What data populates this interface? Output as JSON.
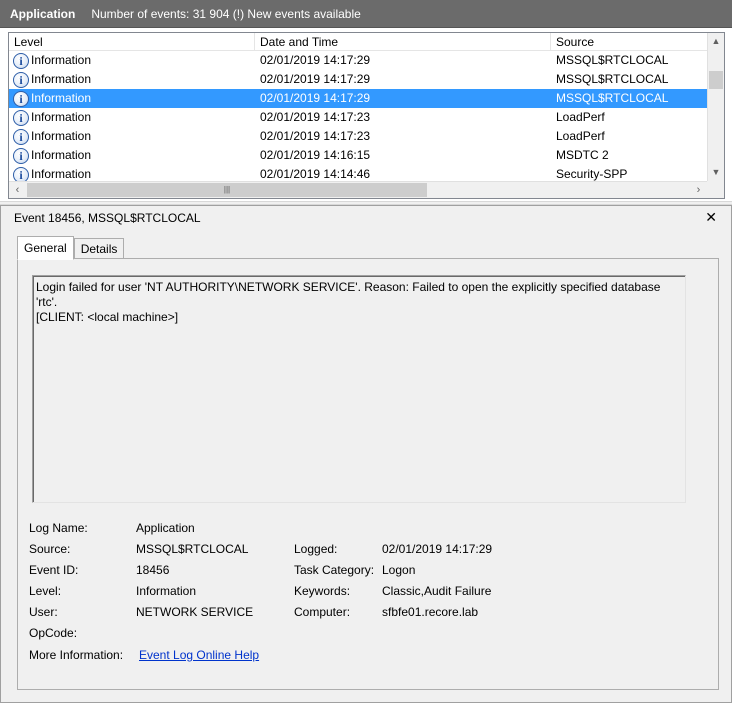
{
  "title_bar": {
    "log_name": "Application",
    "summary": "Number of events: 31 904 (!) New events available"
  },
  "grid": {
    "columns": [
      "Level",
      "Date and Time",
      "Source"
    ],
    "rows": [
      {
        "level": "Information",
        "date": "02/01/2019 14:17:29",
        "source": "MSSQL$RTCLOCAL",
        "selected": false
      },
      {
        "level": "Information",
        "date": "02/01/2019 14:17:29",
        "source": "MSSQL$RTCLOCAL",
        "selected": false
      },
      {
        "level": "Information",
        "date": "02/01/2019 14:17:29",
        "source": "MSSQL$RTCLOCAL",
        "selected": true
      },
      {
        "level": "Information",
        "date": "02/01/2019 14:17:23",
        "source": "LoadPerf",
        "selected": false
      },
      {
        "level": "Information",
        "date": "02/01/2019 14:17:23",
        "source": "LoadPerf",
        "selected": false
      },
      {
        "level": "Information",
        "date": "02/01/2019 14:16:15",
        "source": "MSDTC 2",
        "selected": false
      },
      {
        "level": "Information",
        "date": "02/01/2019 14:14:46",
        "source": "Security-SPP",
        "selected": false
      }
    ],
    "level_icon": "information-icon",
    "selection_color": "#3399ff"
  },
  "detail": {
    "title": "Event 18456, MSSQL$RTCLOCAL",
    "close_glyph": "✕",
    "tabs": [
      "General",
      "Details"
    ],
    "active_tab": "General",
    "message_line1": "Login failed for user 'NT AUTHORITY\\NETWORK SERVICE'. Reason: Failed to open the explicitly specified database 'rtc'.",
    "message_line2": "[CLIENT: <local machine>]",
    "labels": {
      "log_name": "Log Name:",
      "source": "Source:",
      "event_id": "Event ID:",
      "level": "Level:",
      "user": "User:",
      "opcode": "OpCode:",
      "more_info": "More Information:",
      "logged": "Logged:",
      "task_category": "Task Category:",
      "keywords": "Keywords:",
      "computer": "Computer:"
    },
    "values": {
      "log_name": "Application",
      "source": "MSSQL$RTCLOCAL",
      "event_id": "18456",
      "level": "Information",
      "user": "NETWORK SERVICE",
      "opcode": "",
      "more_info_link": "Event Log Online Help",
      "logged": "02/01/2019 14:17:29",
      "task_category": "Logon",
      "keywords": "Classic,Audit Failure",
      "computer": "sfbfe01.recore.lab"
    }
  }
}
